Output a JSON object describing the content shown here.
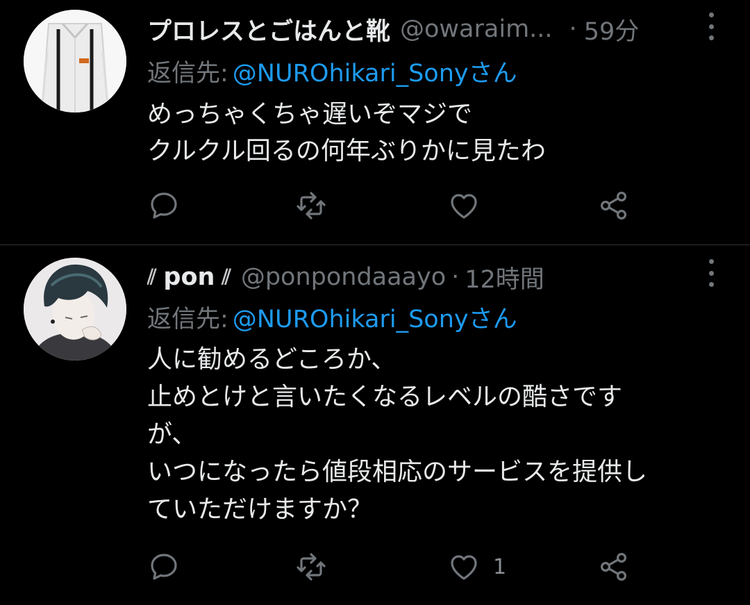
{
  "tweets": [
    {
      "display_name": "プロレスとごはんと靴",
      "handle": "@owaraim...",
      "time": "59分",
      "reply_prefix": "返信先:",
      "reply_target": "@NUROhikari_Sonyさん",
      "text": "めっちゃくちゃ遅いぞマジで\nクルクル回るの何年ぶりかに見たわ",
      "like_count": ""
    },
    {
      "display_name_prefix": "⫽",
      "display_name": "pon",
      "display_name_suffix": "⫽",
      "handle": "@ponpondaaayo",
      "time": "12時間",
      "reply_prefix": "返信先:",
      "reply_target": "@NUROhikari_Sonyさん",
      "text": "人に勧めるどころか、\n止めとけと言いたくなるレベルの酷さです\nが、\nいつになったら値段相応のサービスを提供し\nていただけますか？",
      "like_count": "1"
    }
  ],
  "separator": "·",
  "colors": {
    "background": "#000000",
    "text": "#e7e9ea",
    "muted": "#71767b",
    "link": "#1d9bf0",
    "divider": "#2f3336"
  },
  "icons": [
    "reply-icon",
    "retweet-icon",
    "like-icon",
    "share-icon",
    "more-icon"
  ]
}
